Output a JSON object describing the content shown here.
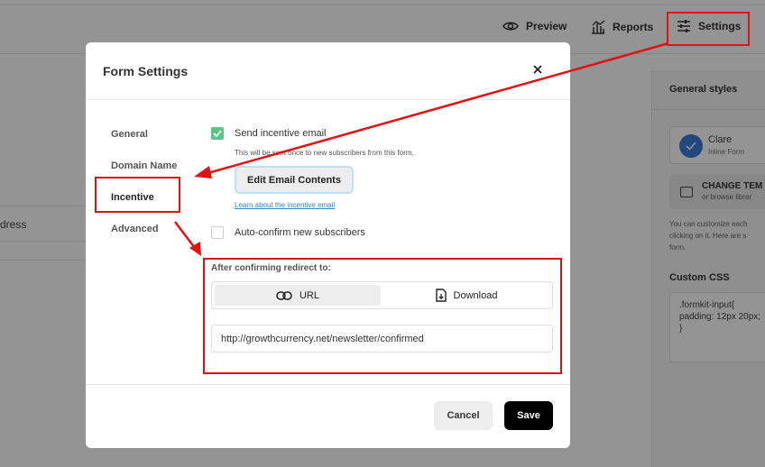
{
  "topbar": {
    "preview_label": "Preview",
    "reports_label": "Reports",
    "settings_label": "Settings"
  },
  "background": {
    "left_field_text": "dress",
    "general_styles_title": "General styles",
    "template": {
      "name": "Clare",
      "subtitle": "Inline Form"
    },
    "change_template": {
      "label": "CHANGE TEM",
      "sublabel": "or browse librar"
    },
    "description": "You can customize each\nclicking on it. Here are s\nform.",
    "custom_css_label": "Custom CSS",
    "custom_css_code": ".formkit-input{\npadding: 12px 20px;\n}"
  },
  "modal": {
    "title": "Form Settings",
    "nav": {
      "general": "General",
      "domain_name": "Domain Name",
      "incentive": "Incentive",
      "advanced": "Advanced"
    },
    "send_incentive_label": "Send incentive email",
    "send_incentive_checked": true,
    "send_incentive_hint": "This will be sent once to new subscribers from this form.",
    "edit_email_button": "Edit Email Contents",
    "learn_link": "Learn about the incentive email",
    "auto_confirm_label": "Auto-confirm new subscribers",
    "auto_confirm_checked": false,
    "redirect_label": "After confirming redirect to:",
    "redirect_options": {
      "url": "URL",
      "download": "Download",
      "selected": "URL"
    },
    "redirect_url": "http://growthcurrency.net/newsletter/confirmed",
    "cancel_button": "Cancel",
    "save_button": "Save"
  },
  "colors": {
    "annotation_red": "#e01313",
    "checkbox_green": "#5cc489",
    "link_blue": "#2f86c9",
    "save_black": "#000000"
  },
  "icons": [
    "eye-icon",
    "reports-icon",
    "sliders-icon",
    "close-icon",
    "check-icon",
    "link-icon",
    "download-file-icon"
  ]
}
